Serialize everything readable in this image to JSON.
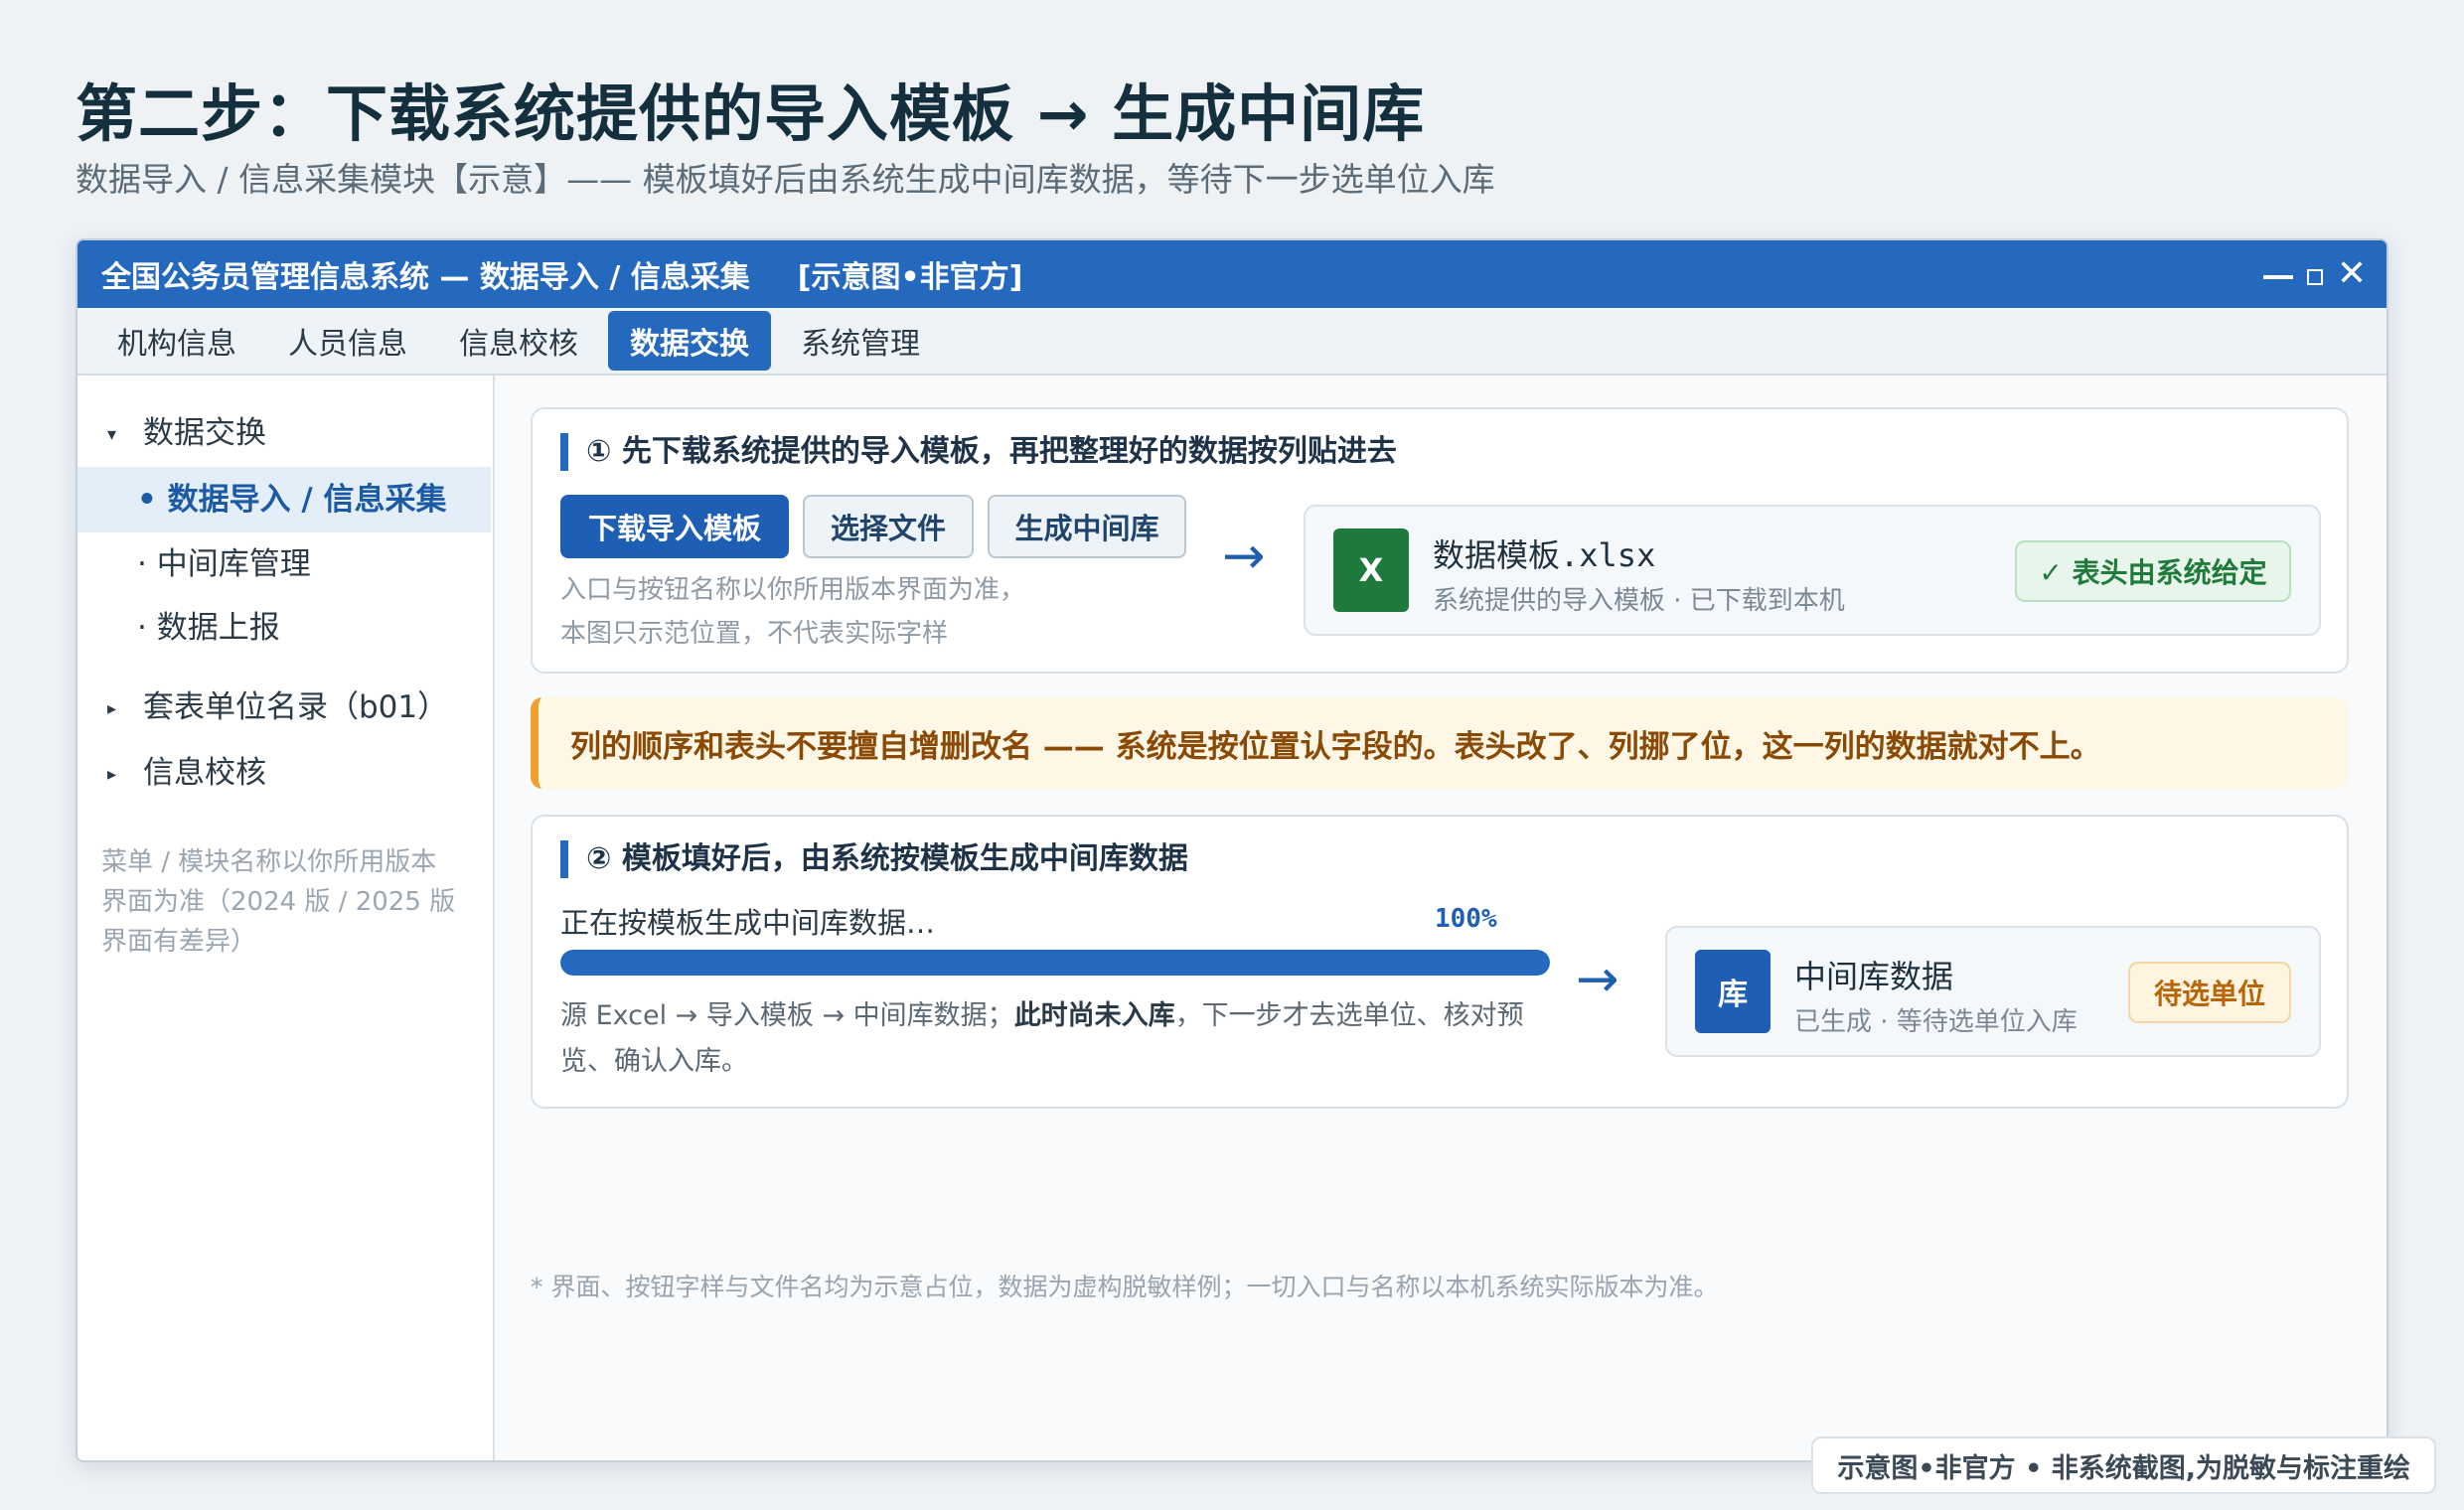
{
  "page": {
    "title": "第二步：下载系统提供的导入模板 → 生成中间库",
    "subtitle": "数据导入 / 信息采集模块【示意】—— 模板填好后由系统生成中间库数据，等待下一步选单位入库"
  },
  "window": {
    "title": "全国公务员管理信息系统 — 数据导入 / 信息采集",
    "tag": "[示意图•非官方]",
    "controls": {
      "minimize": "—",
      "maximize": "□",
      "close": "✕"
    }
  },
  "menu": {
    "tabs": [
      {
        "label": "机构信息",
        "active": false
      },
      {
        "label": "人员信息",
        "active": false
      },
      {
        "label": "信息校核",
        "active": false
      },
      {
        "label": "数据交换",
        "active": true
      },
      {
        "label": "系统管理",
        "active": false
      }
    ]
  },
  "sidebar": {
    "items": [
      {
        "label": "数据交换",
        "caret": "▾"
      },
      {
        "label": "• 数据导入 / 信息采集",
        "active": true
      },
      {
        "label": "· 中间库管理"
      },
      {
        "label": "· 数据上报"
      },
      {
        "label": "套表单位名录（b01）",
        "caret": "▸"
      },
      {
        "label": "信息校核",
        "caret": "▸"
      }
    ],
    "note": "菜单 / 模块名称以你所用版本界面为准（2024 版 / 2025 版界面有差异）"
  },
  "step1": {
    "heading": "① 先下载系统提供的导入模板，再把整理好的数据按列贴进去",
    "buttons": {
      "download": "下载导入模板",
      "choose": "选择文件",
      "generate": "生成中间库"
    },
    "hint_line1": "入口与按钮名称以你所用版本界面为准，",
    "hint_line2": "本图只示范位置，不代表实际字样",
    "arrow": "→",
    "file": {
      "icon_letter": "X",
      "name": "数据模板.xlsx",
      "sub": "系统提供的导入模板 · 已下载到本机",
      "badge": "✓ 表头由系统给定"
    }
  },
  "warning": {
    "text": "列的顺序和表头不要擅自增删改名 —— 系统是按位置认字段的。表头改了、列挪了位，这一列的数据就对不上。"
  },
  "step2": {
    "heading": "② 模板填好后，由系统按模板生成中间库数据",
    "progress_label": "正在按模板生成中间库数据…",
    "progress_text": "100%",
    "progress_value": 1.0,
    "desc_part1": "源 Excel → 导入模板 → 中间库数据；",
    "desc_bold": "此时尚未入库",
    "desc_part2": "，下一步才去选单位、核对预览、确认入库。",
    "arrow": "→",
    "db": {
      "icon_letter": "库",
      "name": "中间库数据",
      "sub": "已生成 · 等待选单位入库",
      "badge": "待选单位"
    }
  },
  "footnote": "* 界面、按钮字样与文件名均为示意占位，数据为虚构脱敏样例；一切入口与名称以本机系统实际版本为准。",
  "stamp": "示意图•非官方 • 非系统截图,为脱敏与标注重绘",
  "colors": {
    "brand": "#2469be",
    "excel_green": "#1e7a3c",
    "db_blue": "#1e5fb5",
    "warning_orange": "#f0a030"
  }
}
